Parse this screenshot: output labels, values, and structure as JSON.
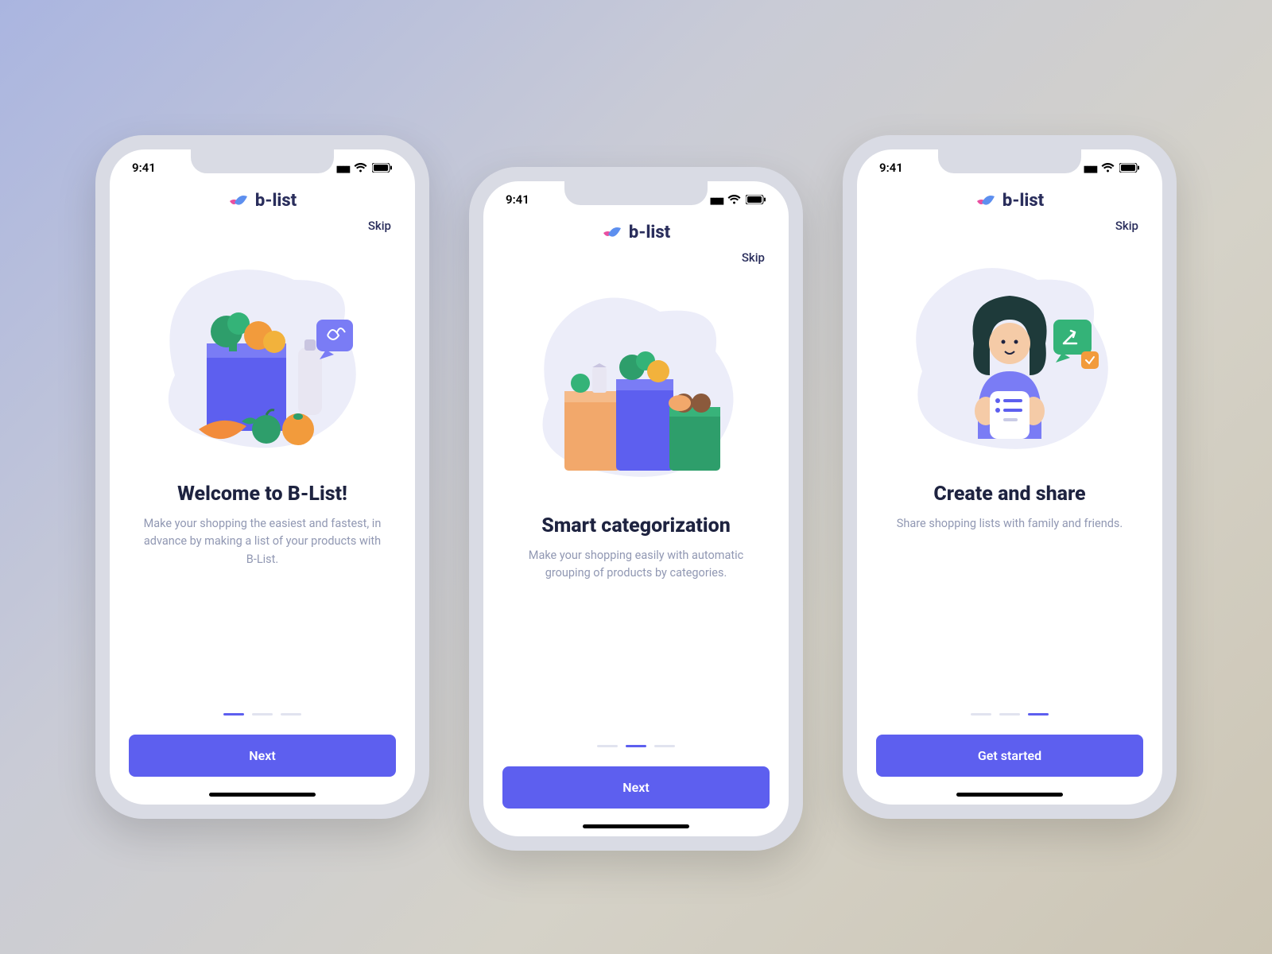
{
  "status": {
    "time": "9:41"
  },
  "brand": {
    "name": "b-list"
  },
  "screens": [
    {
      "skip": "Skip",
      "title": "Welcome to B-List!",
      "subtitle": "Make your shopping the easiest and fastest, in advance by making a list of your products with B-List.",
      "cta": "Next",
      "activeDot": 0
    },
    {
      "skip": "Skip",
      "title": "Smart categorization",
      "subtitle": "Make your shopping easily with automatic grouping of products by categories.",
      "cta": "Next",
      "activeDot": 1
    },
    {
      "skip": "Skip",
      "title": "Create and share",
      "subtitle": "Share shopping lists with family and friends.",
      "cta": "Get started",
      "activeDot": 2
    }
  ],
  "colors": {
    "primary": "#5d5fef",
    "text_dark": "#1e2340",
    "text_muted": "#9198b3"
  }
}
